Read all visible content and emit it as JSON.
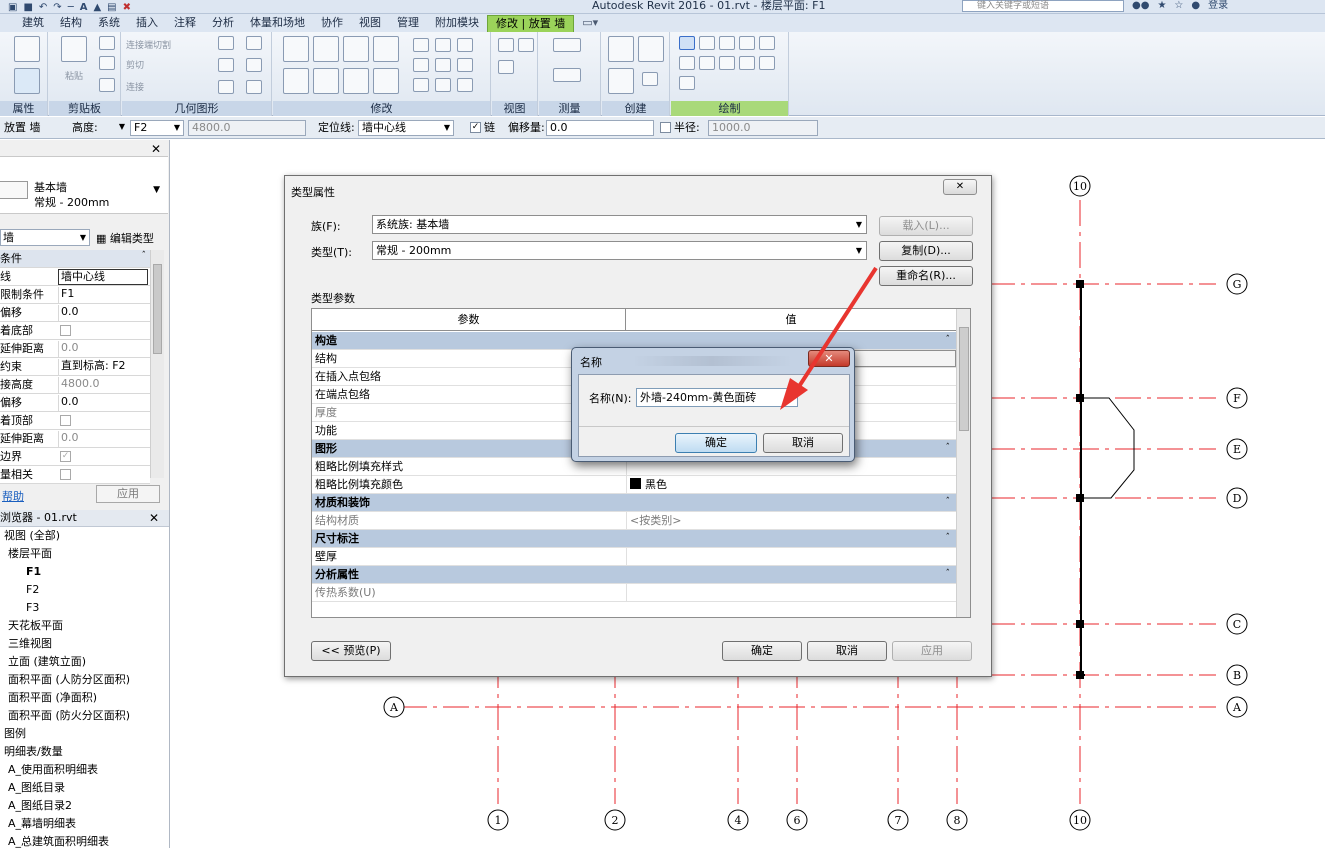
{
  "app": {
    "title": "Autodesk Revit 2016 -    01.rvt - 楼层平面: F1",
    "search_placeholder": "键入关键字或短语",
    "login_label": "登录"
  },
  "tabs": [
    {
      "label": "建筑",
      "active": false
    },
    {
      "label": "结构",
      "active": false
    },
    {
      "label": "系统",
      "active": false
    },
    {
      "label": "插入",
      "active": false
    },
    {
      "label": "注释",
      "active": false
    },
    {
      "label": "分析",
      "active": false
    },
    {
      "label": "体量和场地",
      "active": false
    },
    {
      "label": "协作",
      "active": false
    },
    {
      "label": "视图",
      "active": false
    },
    {
      "label": "管理",
      "active": false
    },
    {
      "label": "附加模块",
      "active": false
    },
    {
      "label": "修改 | 放置 墙",
      "active": true
    }
  ],
  "ribbon": {
    "groups": [
      "属性",
      "剪贴板",
      "几何图形",
      "修改",
      "视图",
      "测量",
      "创建",
      "绘制"
    ],
    "clipboard_paste": "粘贴",
    "geometry_cut": "连接端切割",
    "geometry_cut2": "剪切",
    "geometry_join": "连接"
  },
  "options_bar": {
    "mode_label": "放置 墙",
    "height_label": "高度:",
    "height_value": "F2",
    "height_offset": "4800.0",
    "location_line_label": "定位线:",
    "location_line_value": "墙中心线",
    "chain_label": "链",
    "offset_label": "偏移量:",
    "offset_value": "0.0",
    "radius_label": "半径:",
    "radius_value": "1000.0"
  },
  "properties": {
    "family": "基本墙",
    "type": "常规 - 200mm",
    "instance_dropdown": "墙",
    "edit_type_label": "编辑类型",
    "rows": [
      {
        "key": "条件",
        "value": "",
        "group": true
      },
      {
        "key": "线",
        "value": "墙中心线",
        "boxed": true
      },
      {
        "key": "限制条件",
        "value": "F1"
      },
      {
        "key": "偏移",
        "value": "0.0"
      },
      {
        "key": "着底部",
        "checkbox": true
      },
      {
        "key": "延伸距离",
        "value": "0.0",
        "disabled": true
      },
      {
        "key": "约束",
        "value": "直到标高: F2"
      },
      {
        "key": "接高度",
        "value": "4800.0",
        "disabled": true
      },
      {
        "key": "偏移",
        "value": "0.0"
      },
      {
        "key": "着顶部",
        "checkbox": true
      },
      {
        "key": "延伸距离",
        "value": "0.0",
        "disabled": true
      },
      {
        "key": "边界",
        "checkbox": true,
        "checked": true
      },
      {
        "key": "量相关",
        "checkbox": true
      }
    ],
    "help_link": "帮助",
    "apply_label": "应用"
  },
  "browser": {
    "title": "浏览器 - 01.rvt",
    "items": [
      {
        "label": "视图 (全部)",
        "indent": 4
      },
      {
        "label": "楼层平面",
        "indent": 8
      },
      {
        "label": "F1",
        "indent": 26,
        "bold": true
      },
      {
        "label": "F2",
        "indent": 26
      },
      {
        "label": "F3",
        "indent": 26
      },
      {
        "label": "天花板平面",
        "indent": 8
      },
      {
        "label": "三维视图",
        "indent": 8
      },
      {
        "label": "立面 (建筑立面)",
        "indent": 8
      },
      {
        "label": "面积平面 (人防分区面积)",
        "indent": 8
      },
      {
        "label": "面积平面 (净面积)",
        "indent": 8
      },
      {
        "label": "面积平面 (防火分区面积)",
        "indent": 8
      },
      {
        "label": "图例",
        "indent": 4
      },
      {
        "label": "明细表/数量",
        "indent": 4
      },
      {
        "label": "A_使用面积明细表",
        "indent": 8
      },
      {
        "label": "A_图纸目录",
        "indent": 8
      },
      {
        "label": "A_图纸目录2",
        "indent": 8
      },
      {
        "label": "A_幕墙明细表",
        "indent": 8
      },
      {
        "label": "A_总建筑面积明细表",
        "indent": 8
      }
    ]
  },
  "type_properties": {
    "title": "类型属性",
    "family_label": "族(F):",
    "family_value": "系统族: 基本墙",
    "type_label": "类型(T):",
    "type_value": "常规 - 200mm",
    "load_button": "载入(L)...",
    "duplicate_button": "复制(D)...",
    "rename_button": "重命名(R)...",
    "section_label": "类型参数",
    "col_param": "参数",
    "col_value": "值",
    "rows": [
      {
        "key": "构造",
        "group": true
      },
      {
        "key": "结构",
        "value": "",
        "button": true
      },
      {
        "key": "在插入点包络",
        "value": ""
      },
      {
        "key": "在端点包络",
        "value": ""
      },
      {
        "key": "厚度",
        "value": "",
        "disabled": true
      },
      {
        "key": "功能",
        "value": ""
      },
      {
        "key": "图形",
        "group": true
      },
      {
        "key": "粗略比例填充样式",
        "value": ""
      },
      {
        "key": "粗略比例填充颜色",
        "value": "黑色",
        "swatch": "#000000"
      },
      {
        "key": "材质和装饰",
        "group": true
      },
      {
        "key": "结构材质",
        "value": "<按类别>",
        "disabled": true
      },
      {
        "key": "尺寸标注",
        "group": true
      },
      {
        "key": "壁厚",
        "value": ""
      },
      {
        "key": "分析属性",
        "group": true
      },
      {
        "key": "传热系数(U)",
        "value": "",
        "disabled": true
      }
    ],
    "preview_button": "<< 预览(P)",
    "ok_button": "确定",
    "cancel_button": "取消",
    "apply_button": "应用"
  },
  "name_dialog": {
    "title": "名称",
    "label": "名称(N):",
    "value": "外墙-240mm-黄色面砖",
    "ok_button": "确定",
    "cancel_button": "取消"
  },
  "grid_labels": {
    "vertical": [
      "1",
      "2",
      "4",
      "6",
      "7",
      "8",
      "10"
    ],
    "horizontal": [
      "G",
      "F",
      "E",
      "D",
      "C",
      "B",
      "A"
    ]
  },
  "colors": {
    "ribbon_active": "#9bd35a",
    "grid_line": "#e8262b",
    "arrow": "#e8352f",
    "dialog_group_row": "#b8c9de"
  }
}
